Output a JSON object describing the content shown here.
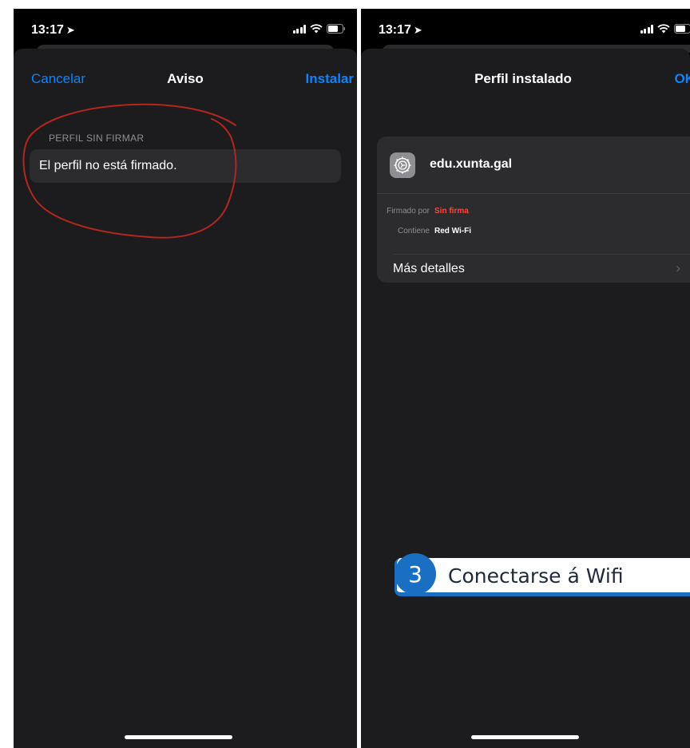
{
  "left_screen": {
    "status": {
      "time": "13:17"
    },
    "nav": {
      "cancel_label": "Cancelar",
      "title": "Aviso",
      "install_label": "Instalar"
    },
    "section_header": "PERFIL SIN FIRMAR",
    "cell_text": "El perfil no está firmado.",
    "annotation_color": "#b3261e"
  },
  "right_screen": {
    "status": {
      "time": "13:17"
    },
    "nav": {
      "title": "Perfil instalado",
      "ok_label": "OK"
    },
    "profile": {
      "name": "edu.xunta.gal",
      "icon": "settings-gear-icon",
      "signed_by_label": "Firmado por",
      "signed_by_value": "Sin firma",
      "contains_label": "Contiene",
      "contains_value": "Red Wi-Fi",
      "more_details_label": "Más detalles"
    },
    "step": {
      "number": "3",
      "text": "Conectarse á Wifi"
    }
  },
  "colors": {
    "accent_blue": "#0a84ff",
    "unsigned_red": "#ff453a",
    "sheet_bg": "#1c1c1e",
    "cell_bg": "#2c2c2e",
    "step_blue": "#1b6fc2"
  }
}
